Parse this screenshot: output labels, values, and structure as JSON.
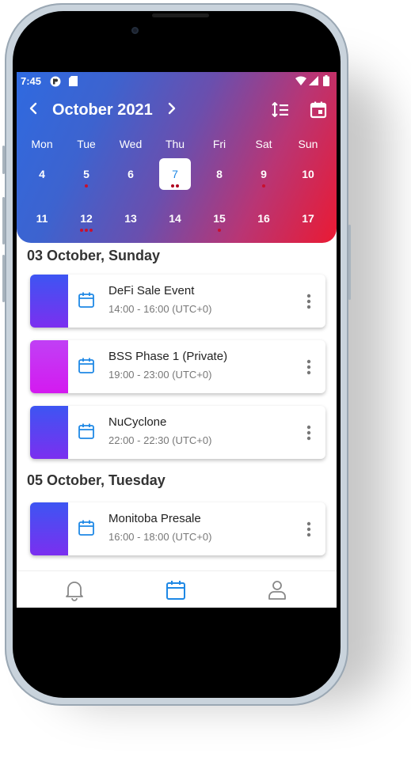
{
  "colors": {
    "header_gradient": [
      "#2f6ae0",
      "#6a4fae",
      "#ea1a33"
    ],
    "accent_blue": "#1e88e5",
    "event_dot": "#c8102e",
    "card_bar_blue_purple": [
      "#3d55f2",
      "#7b2ff0"
    ],
    "card_bar_magenta": [
      "#c040f5",
      "#d41af0"
    ]
  },
  "status_bar": {
    "time": "7:45",
    "icons": [
      "app-icon",
      "sd-card-icon",
      "wifi-icon",
      "signal-icon",
      "battery-icon"
    ]
  },
  "calendar": {
    "month_label": "October 2021",
    "prev_icon": "chevron-left-icon",
    "next_icon": "chevron-right-icon",
    "actions": [
      "sort-list-icon",
      "calendar-view-icon"
    ],
    "weekdays": [
      "Mon",
      "Tue",
      "Wed",
      "Thu",
      "Fri",
      "Sat",
      "Sun"
    ],
    "weeks": [
      [
        {
          "day": "4",
          "dots": 0
        },
        {
          "day": "5",
          "dots": 1
        },
        {
          "day": "6",
          "dots": 0
        },
        {
          "day": "7",
          "dots": 2,
          "today": true
        },
        {
          "day": "8",
          "dots": 0
        },
        {
          "day": "9",
          "dots": 1
        },
        {
          "day": "10",
          "dots": 0
        }
      ],
      [
        {
          "day": "11",
          "dots": 0
        },
        {
          "day": "12",
          "dots": 3
        },
        {
          "day": "13",
          "dots": 0
        },
        {
          "day": "14",
          "dots": 0
        },
        {
          "day": "15",
          "dots": 1
        },
        {
          "day": "16",
          "dots": 0
        },
        {
          "day": "17",
          "dots": 0
        }
      ]
    ]
  },
  "sections": [
    {
      "date_label": "03 October,  Sunday",
      "events": [
        {
          "title": "DeFi Sale Event",
          "time": "14:00 - 16:00 (UTC+0)",
          "bar": "blue"
        },
        {
          "title": "BSS Phase 1 (Private)",
          "time": "19:00 - 23:00 (UTC+0)",
          "bar": "magenta"
        },
        {
          "title": "NuCyclone",
          "time": "22:00 - 22:30 (UTC+0)",
          "bar": "blue"
        }
      ]
    },
    {
      "date_label": "05 October,  Tuesday",
      "events": [
        {
          "title": "Monitoba Presale",
          "time": "16:00 - 18:00 (UTC+0)",
          "bar": "blue"
        }
      ]
    }
  ],
  "bottom_nav": [
    {
      "icon": "bell-icon",
      "active": false
    },
    {
      "icon": "calendar-icon",
      "active": true
    },
    {
      "icon": "person-icon",
      "active": false
    }
  ]
}
